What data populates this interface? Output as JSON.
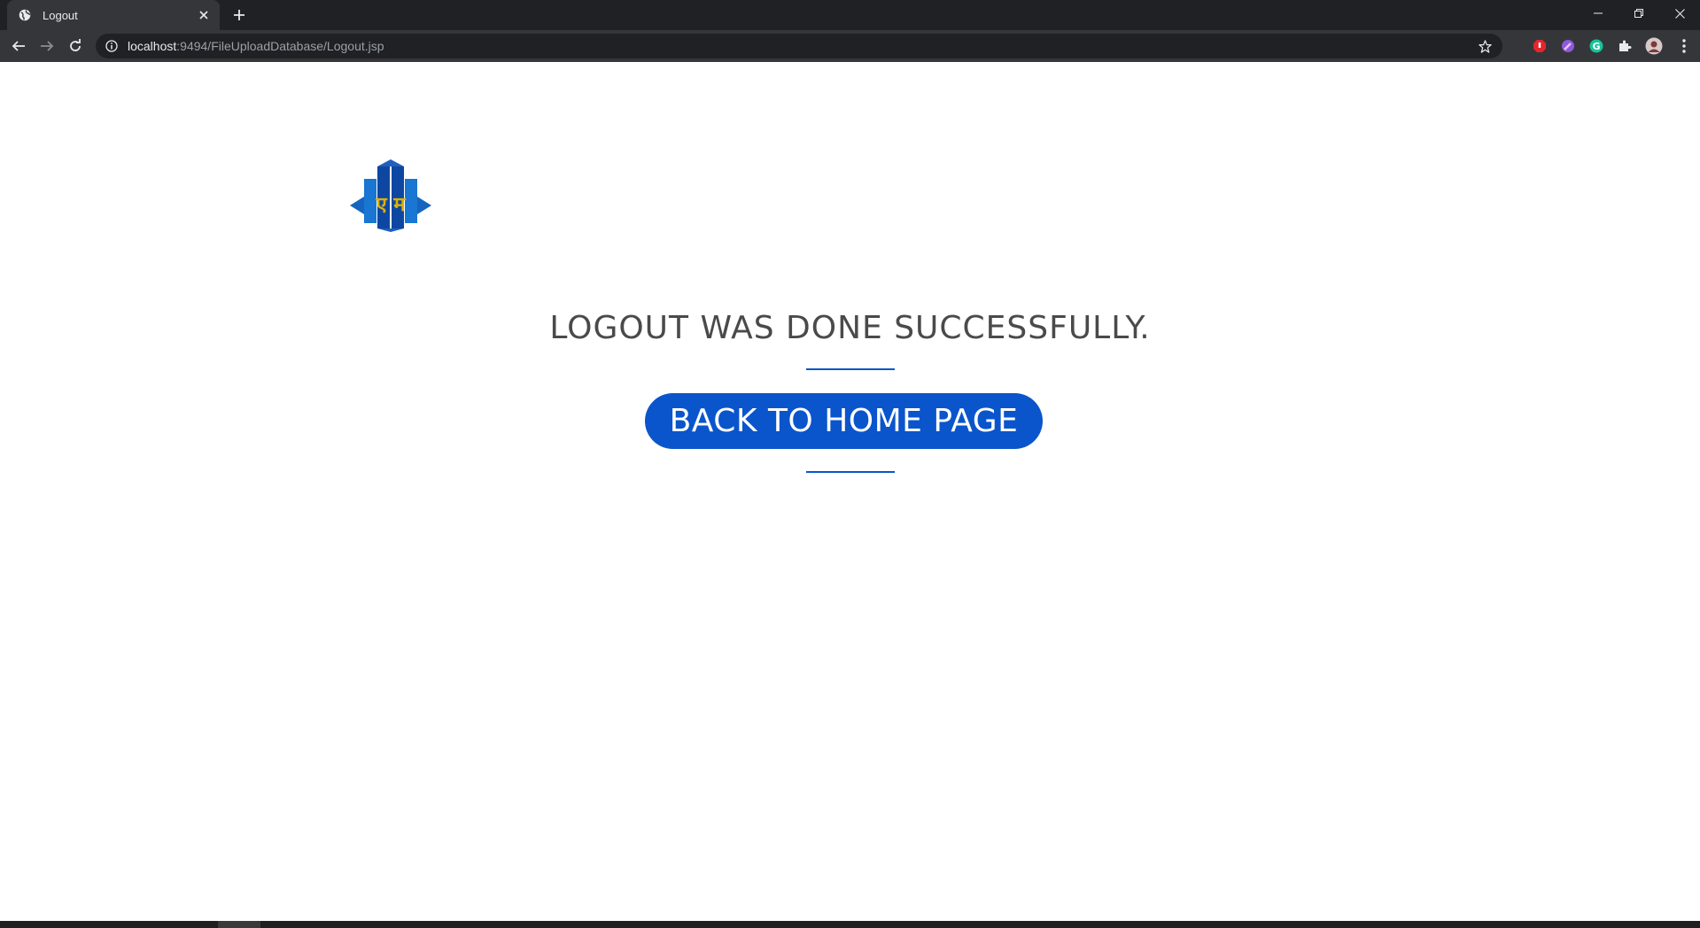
{
  "browser": {
    "tab": {
      "title": "Logout"
    },
    "address": {
      "host": "localhost",
      "path": ":9494/FileUploadDatabase/Logout.jsp"
    }
  },
  "page": {
    "heading": "LOGOUT WAS DONE SUCCESSFULLY.",
    "home_button_label": "BACK TO HOME PAGE",
    "logo_text": "ए म"
  },
  "colors": {
    "accent": "#0a55cc",
    "heading": "#4a4a4a",
    "chrome_dark": "#202124",
    "chrome_light": "#35363a"
  },
  "icons": [
    "globe-icon",
    "close-icon",
    "plus-icon",
    "minimize-icon",
    "restore-icon",
    "window-close-icon",
    "back-arrow-icon",
    "forward-arrow-icon",
    "reload-icon",
    "info-icon",
    "star-icon",
    "adblock-extension-icon",
    "color-picker-extension-icon",
    "grammarly-extension-icon",
    "puzzle-extension-icon",
    "profile-avatar-icon",
    "kebab-menu-icon"
  ]
}
